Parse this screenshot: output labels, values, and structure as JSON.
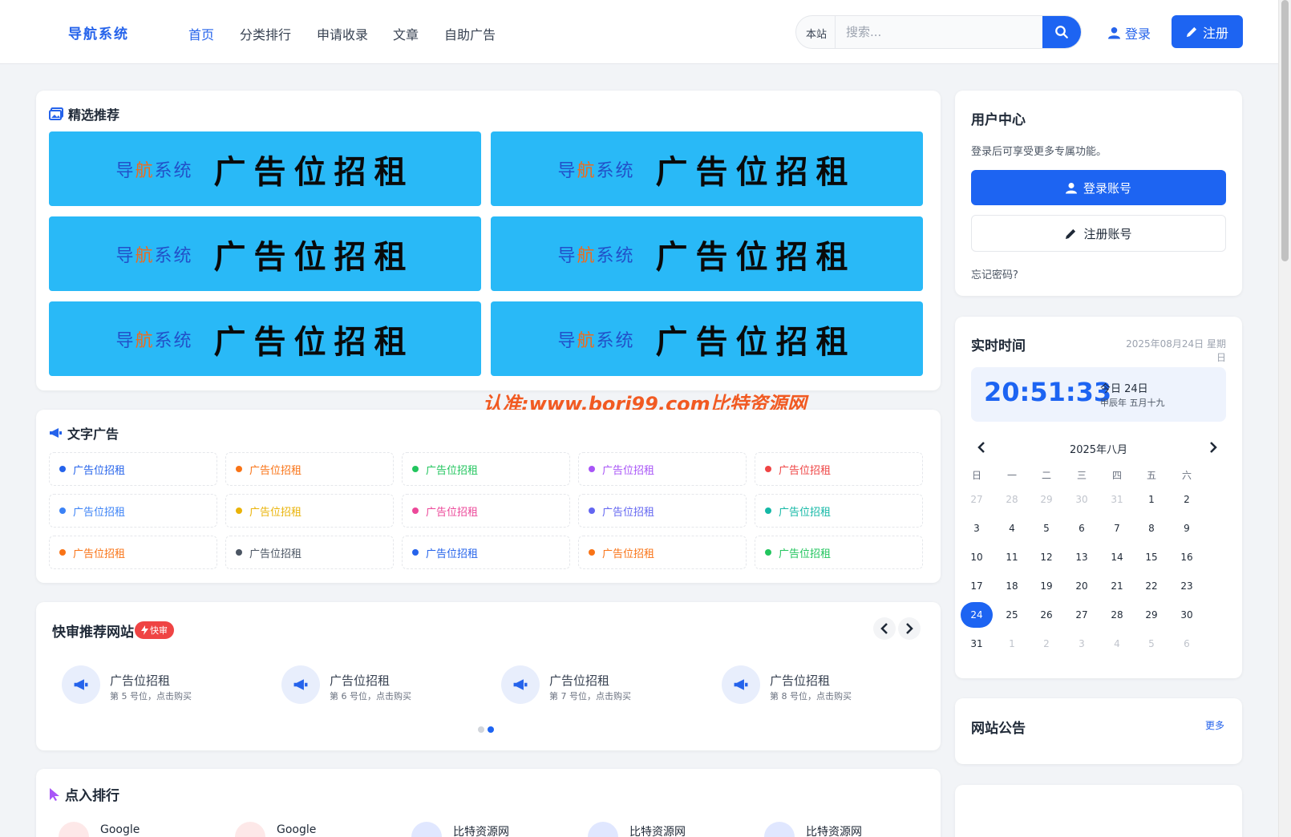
{
  "header": {
    "logo": "导航系统",
    "nav": [
      "首页",
      "分类排行",
      "申请收录",
      "文章",
      "自助广告"
    ],
    "search_scope": "本站",
    "search_placeholder": "搜索...",
    "login_label": "登录",
    "register_label": "注册"
  },
  "featured": {
    "title": "精选推荐",
    "banners": [
      {
        "small_pre": "导",
        "small_hl": "航",
        "small_post": "系统",
        "big": "广告位招租"
      },
      {
        "small_pre": "导",
        "small_hl": "航",
        "small_post": "系统",
        "big": "广告位招租"
      },
      {
        "small_pre": "导",
        "small_hl": "航",
        "small_post": "系统",
        "big": "广告位招租"
      },
      {
        "small_pre": "导",
        "small_hl": "航",
        "small_post": "系统",
        "big": "广告位招租"
      },
      {
        "small_pre": "导",
        "small_hl": "航",
        "small_post": "系统",
        "big": "广告位招租"
      },
      {
        "small_pre": "导",
        "small_hl": "航",
        "small_post": "系统",
        "big": "广告位招租"
      }
    ]
  },
  "watermark": "认准:www.bori99.com比特资源网",
  "text_ads": {
    "title": "文字广告",
    "items": [
      {
        "label": "广告位招租",
        "color": "#2563eb"
      },
      {
        "label": "广告位招租",
        "color": "#f97316"
      },
      {
        "label": "广告位招租",
        "color": "#22c55e"
      },
      {
        "label": "广告位招租",
        "color": "#a855f7"
      },
      {
        "label": "广告位招租",
        "color": "#ef4444"
      },
      {
        "label": "广告位招租",
        "color": "#3b82f6"
      },
      {
        "label": "广告位招租",
        "color": "#eab308"
      },
      {
        "label": "广告位招租",
        "color": "#ec4899"
      },
      {
        "label": "广告位招租",
        "color": "#6366f1"
      },
      {
        "label": "广告位招租",
        "color": "#14b8a6"
      },
      {
        "label": "广告位招租",
        "color": "#f97316"
      },
      {
        "label": "广告位招租",
        "color": "#4b5563"
      },
      {
        "label": "广告位招租",
        "color": "#2563eb"
      },
      {
        "label": "广告位招租",
        "color": "#f97316"
      },
      {
        "label": "广告位招租",
        "color": "#22c55e"
      }
    ]
  },
  "quick_review": {
    "title": "快审推荐网站",
    "badge": "快审",
    "items": [
      {
        "name": "广告位招租",
        "desc": "第 5 号位，点击购买"
      },
      {
        "name": "广告位招租",
        "desc": "第 6 号位，点击购买"
      },
      {
        "name": "广告位招租",
        "desc": "第 7 号位，点击购买"
      },
      {
        "name": "广告位招租",
        "desc": "第 8 号位，点击购买"
      }
    ]
  },
  "click_rank": {
    "title": "点入排行",
    "items": [
      "Google",
      "Google",
      "比特资源网",
      "比特资源网",
      "比特资源网"
    ]
  },
  "user_center": {
    "title": "用户中心",
    "desc": "登录后可享受更多专属功能。",
    "login_btn": "登录账号",
    "register_btn": "注册账号",
    "forgot": "忘记密码?"
  },
  "clock": {
    "title": "实时时间",
    "date": "2025年08月24日 星期日",
    "time": "20:51:33",
    "today": "今日 24日",
    "lunar": "甲辰年 五月十九"
  },
  "calendar": {
    "month": "2025年八月",
    "weekdays": [
      "日",
      "一",
      "二",
      "三",
      "四",
      "五",
      "六"
    ],
    "today": "24",
    "days": [
      [
        "27",
        "28",
        "29",
        "30",
        "31",
        "1",
        "2"
      ],
      [
        "3",
        "4",
        "5",
        "6",
        "7",
        "8",
        "9"
      ],
      [
        "10",
        "11",
        "12",
        "13",
        "14",
        "15",
        "16"
      ],
      [
        "17",
        "18",
        "19",
        "20",
        "21",
        "22",
        "23"
      ],
      [
        "24",
        "25",
        "26",
        "27",
        "28",
        "29",
        "30"
      ],
      [
        "31",
        "1",
        "2",
        "3",
        "4",
        "5",
        "6"
      ]
    ]
  },
  "notice": {
    "title": "网站公告",
    "more": "更多"
  },
  "colors": {
    "primary": "#1d64f2",
    "banner": "#29b9f7",
    "watermark": "#f15a22"
  }
}
